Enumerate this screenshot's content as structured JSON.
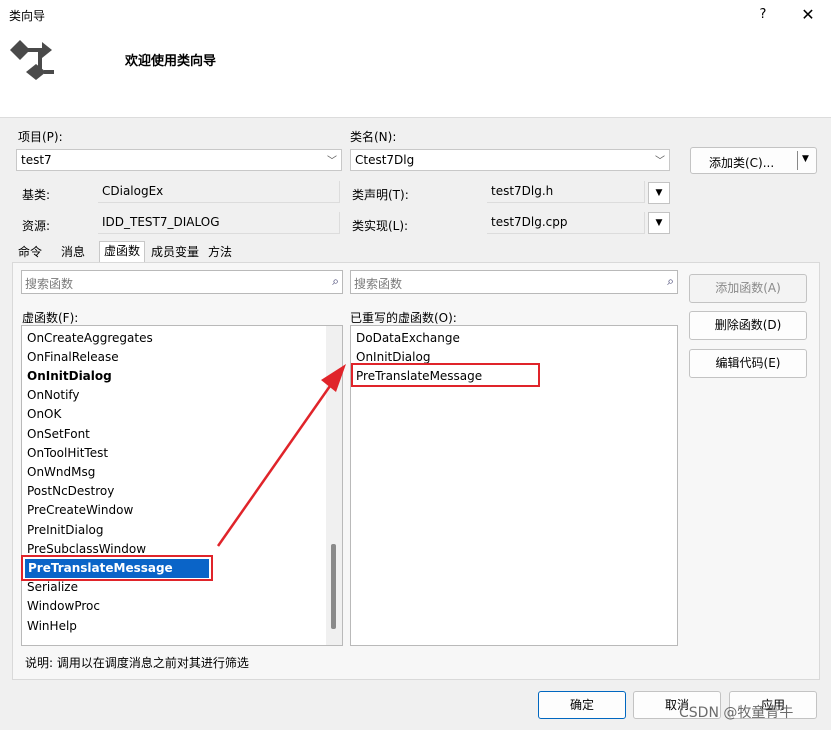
{
  "window": {
    "title": "类向导",
    "help": "?",
    "close": "✕"
  },
  "banner": {
    "welcome": "欢迎使用类向导"
  },
  "fields": {
    "project_label": "项目(P):",
    "project_value": "test7",
    "classname_label": "类名(N):",
    "classname_value": "Ctest7Dlg",
    "baseclass_label": "基类:",
    "baseclass_value": "CDialogEx",
    "resource_label": "资源:",
    "resource_value": "IDD_TEST7_DIALOG",
    "decl_label": "类声明(T):",
    "decl_value": "test7Dlg.h",
    "impl_label": "类实现(L):",
    "impl_value": "test7Dlg.cpp"
  },
  "buttons": {
    "add_class": "添加类(C)...",
    "add_function": "添加函数(A)",
    "delete_function": "删除函数(D)",
    "edit_code": "编辑代码(E)",
    "ok": "确定",
    "cancel": "取消",
    "apply": "应用"
  },
  "tabs": [
    "命令",
    "消息",
    "虚函数",
    "成员变量",
    "方法"
  ],
  "search": {
    "left_placeholder": "搜索函数",
    "right_placeholder": "搜索函数"
  },
  "lists": {
    "virtual_label": "虚函数(F):",
    "overridden_label": "已重写的虚函数(O):",
    "virtual_items": [
      "OnCreateAggregates",
      "OnFinalRelease",
      "OnInitDialog",
      "OnNotify",
      "OnOK",
      "OnSetFont",
      "OnToolHitTest",
      "OnWndMsg",
      "PostNcDestroy",
      "PreCreateWindow",
      "PreInitDialog",
      "PreSubclassWindow",
      "PreTranslateMessage",
      "Serialize",
      "WindowProc",
      "WinHelp"
    ],
    "overridden_items": [
      "DoDataExchange",
      "OnInitDialog",
      "PreTranslateMessage"
    ]
  },
  "description": "说明:   调用以在调度消息之前对其进行筛选",
  "watermark": "CSDN @牧童青牛",
  "colors": {
    "selection": "#0a64c8",
    "annotation": "#e0242a"
  }
}
